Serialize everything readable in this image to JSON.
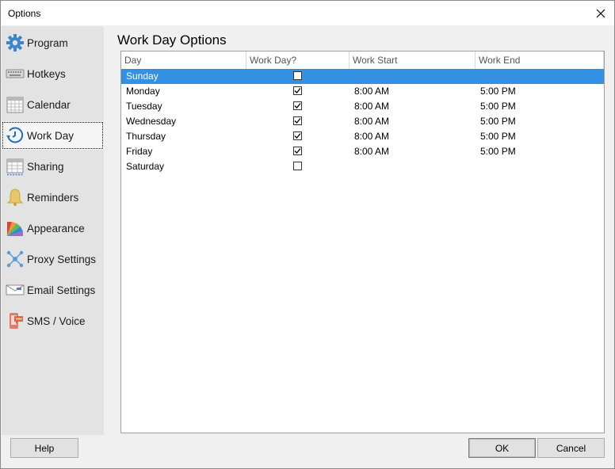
{
  "window": {
    "title": "Options"
  },
  "sidebar": {
    "items": [
      {
        "label": "Program",
        "icon": "gear-icon"
      },
      {
        "label": "Hotkeys",
        "icon": "keyboard-icon"
      },
      {
        "label": "Calendar",
        "icon": "calendar-icon"
      },
      {
        "label": "Work Day",
        "icon": "clock-arrow-icon",
        "selected": true
      },
      {
        "label": "Sharing",
        "icon": "shared-calendar-icon"
      },
      {
        "label": "Reminders",
        "icon": "bell-icon"
      },
      {
        "label": "Appearance",
        "icon": "color-palette-icon"
      },
      {
        "label": "Proxy Settings",
        "icon": "network-icon"
      },
      {
        "label": "Email Settings",
        "icon": "envelope-icon"
      },
      {
        "label": "SMS / Voice",
        "icon": "phone-message-icon"
      }
    ]
  },
  "main": {
    "title": "Work Day Options",
    "columns": [
      "Day",
      "Work Day?",
      "Work Start",
      "Work End"
    ],
    "rows": [
      {
        "day": "Sunday",
        "work_day": false,
        "start": "",
        "end": "",
        "selected": true
      },
      {
        "day": "Monday",
        "work_day": true,
        "start": "8:00 AM",
        "end": "5:00 PM"
      },
      {
        "day": "Tuesday",
        "work_day": true,
        "start": "8:00 AM",
        "end": "5:00 PM"
      },
      {
        "day": "Wednesday",
        "work_day": true,
        "start": "8:00 AM",
        "end": "5:00 PM"
      },
      {
        "day": "Thursday",
        "work_day": true,
        "start": "8:00 AM",
        "end": "5:00 PM"
      },
      {
        "day": "Friday",
        "work_day": true,
        "start": "8:00 AM",
        "end": "5:00 PM"
      },
      {
        "day": "Saturday",
        "work_day": false,
        "start": "",
        "end": ""
      }
    ]
  },
  "footer": {
    "help_label": "Help",
    "ok_label": "OK",
    "cancel_label": "Cancel"
  },
  "colors": {
    "selection": "#3390e3",
    "sidebar_bg": "#e3e3e3",
    "accent_icon": "#2f7fc8"
  }
}
